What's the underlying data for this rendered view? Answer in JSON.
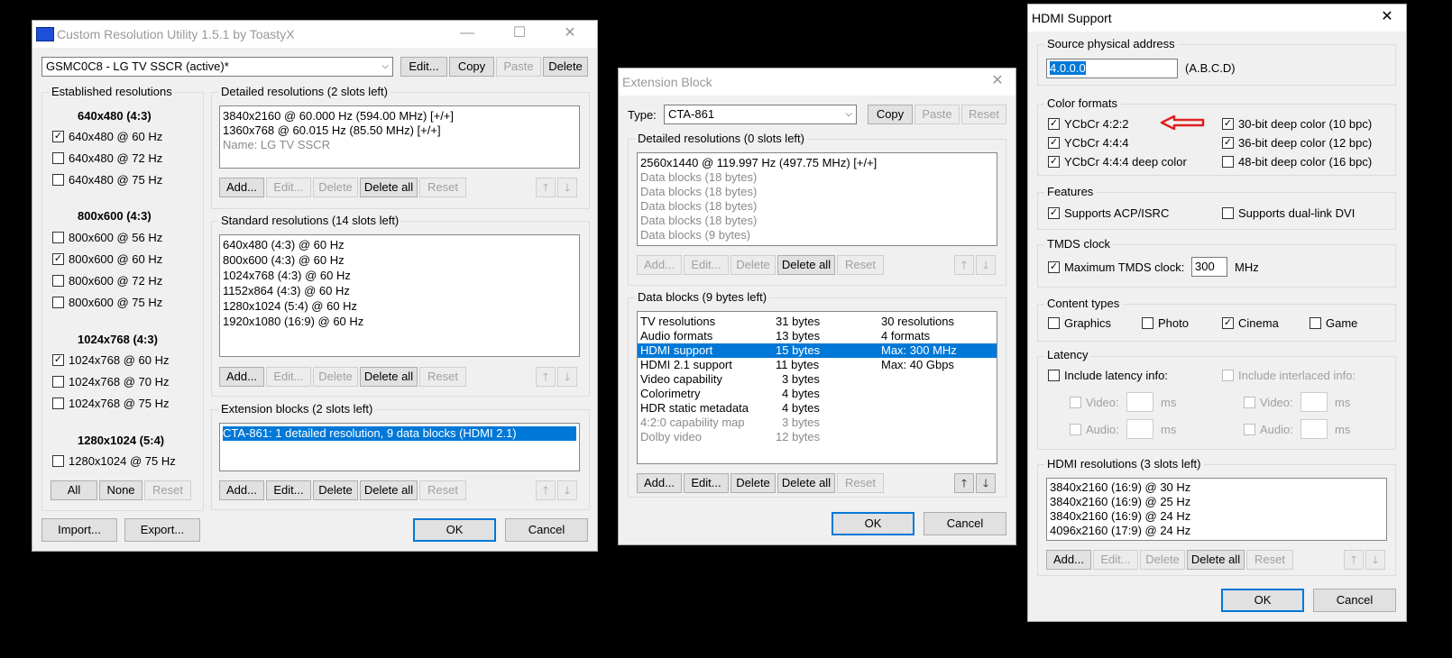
{
  "cru": {
    "title": "Custom Resolution Utility 1.5.1 by ToastyX",
    "monitor": "GSMC0C8 - LG TV SSCR (active)*",
    "top_buttons": [
      "Edit...",
      "Copy",
      "Paste",
      "Delete"
    ],
    "established": {
      "label": "Established resolutions",
      "groups": [
        {
          "header": "640x480 (4:3)",
          "items": [
            {
              "label": "640x480 @ 60 Hz",
              "checked": true
            },
            {
              "label": "640x480 @ 72 Hz",
              "checked": false
            },
            {
              "label": "640x480 @ 75 Hz",
              "checked": false
            }
          ]
        },
        {
          "header": "800x600 (4:3)",
          "items": [
            {
              "label": "800x600 @ 56 Hz",
              "checked": false
            },
            {
              "label": "800x600 @ 60 Hz",
              "checked": true
            },
            {
              "label": "800x600 @ 72 Hz",
              "checked": false
            },
            {
              "label": "800x600 @ 75 Hz",
              "checked": false
            }
          ]
        },
        {
          "header": "1024x768 (4:3)",
          "items": [
            {
              "label": "1024x768 @ 60 Hz",
              "checked": true
            },
            {
              "label": "1024x768 @ 70 Hz",
              "checked": false
            },
            {
              "label": "1024x768 @ 75 Hz",
              "checked": false
            }
          ]
        },
        {
          "header": "1280x1024 (5:4)",
          "items": [
            {
              "label": "1280x1024 @ 75 Hz",
              "checked": false
            }
          ]
        }
      ],
      "buttons": [
        "All",
        "None",
        "Reset"
      ]
    },
    "detailed": {
      "label": "Detailed resolutions (2 slots left)",
      "items": [
        "3840x2160 @ 60.000 Hz (594.00 MHz) [+/+]",
        "1360x768 @ 60.015 Hz (85.50 MHz) [+/+]",
        "Name: LG TV SSCR"
      ]
    },
    "standard": {
      "label": "Standard resolutions (14 slots left)",
      "items": [
        "640x480 (4:3) @ 60 Hz",
        "800x600 (4:3) @ 60 Hz",
        "1024x768 (4:3) @ 60 Hz",
        "1152x864 (4:3) @ 60 Hz",
        "1280x1024 (5:4) @ 60 Hz",
        "1920x1080 (16:9) @ 60 Hz"
      ]
    },
    "extension": {
      "label": "Extension blocks (2 slots left)",
      "items": [
        "CTA-861: 1 detailed resolution, 9 data blocks (HDMI 2.1)"
      ]
    },
    "list_buttons": [
      "Add...",
      "Edit...",
      "Delete",
      "Delete all",
      "Reset"
    ],
    "bottom": {
      "import": "Import...",
      "export": "Export...",
      "ok": "OK",
      "cancel": "Cancel"
    }
  },
  "ext": {
    "title": "Extension Block",
    "type_label": "Type:",
    "type_value": "CTA-861",
    "top_buttons": [
      "Copy",
      "Paste",
      "Reset"
    ],
    "detailed": {
      "label": "Detailed resolutions (0 slots left)",
      "items": [
        "2560x1440 @ 119.997 Hz (497.75 MHz) [+/+]",
        "Data blocks (18 bytes)",
        "Data blocks (18 bytes)",
        "Data blocks (18 bytes)",
        "Data blocks (18 bytes)",
        "Data blocks (9 bytes)"
      ]
    },
    "datablocks": {
      "label": "Data blocks (9 bytes left)",
      "rows": [
        {
          "name": "TV resolutions",
          "size": "31 bytes",
          "info": "30 resolutions"
        },
        {
          "name": "Audio formats",
          "size": "13 bytes",
          "info": "4 formats"
        },
        {
          "name": "HDMI support",
          "size": "15 bytes",
          "info": "Max: 300 MHz"
        },
        {
          "name": "HDMI 2.1 support",
          "size": "11 bytes",
          "info": "Max: 40 Gbps"
        },
        {
          "name": "Video capability",
          "size": "3 bytes",
          "info": ""
        },
        {
          "name": "Colorimetry",
          "size": "4 bytes",
          "info": ""
        },
        {
          "name": "HDR static metadata",
          "size": "4 bytes",
          "info": ""
        },
        {
          "name": "4:2:0 capability map",
          "size": "3 bytes",
          "info": ""
        },
        {
          "name": "Dolby video",
          "size": "12 bytes",
          "info": ""
        }
      ]
    },
    "list_buttons": [
      "Add...",
      "Edit...",
      "Delete",
      "Delete all",
      "Reset"
    ],
    "ok": "OK",
    "cancel": "Cancel"
  },
  "hdmi": {
    "title": "HDMI Support",
    "source": {
      "label": "Source physical address",
      "value": "4.0.0.0",
      "hint": "(A.B.C.D)"
    },
    "color": {
      "label": "Color formats",
      "left": [
        {
          "label": "YCbCr 4:2:2",
          "checked": true
        },
        {
          "label": "YCbCr 4:4:4",
          "checked": true
        },
        {
          "label": "YCbCr 4:4:4 deep color",
          "checked": true
        }
      ],
      "right": [
        {
          "label": "30-bit deep color (10 bpc)",
          "checked": true
        },
        {
          "label": "36-bit deep color (12 bpc)",
          "checked": true
        },
        {
          "label": "48-bit deep color (16 bpc)",
          "checked": false
        }
      ]
    },
    "features": {
      "label": "Features",
      "acp": "Supports ACP/ISRC",
      "dual": "Supports dual-link DVI"
    },
    "tmds": {
      "label": "TMDS clock",
      "check": "Maximum TMDS clock:",
      "value": "300",
      "unit": "MHz"
    },
    "content": {
      "label": "Content types",
      "items": [
        {
          "label": "Graphics",
          "checked": false
        },
        {
          "label": "Photo",
          "checked": false
        },
        {
          "label": "Cinema",
          "checked": true
        },
        {
          "label": "Game",
          "checked": false
        }
      ]
    },
    "latency": {
      "label": "Latency",
      "include": "Include latency info:",
      "interlaced": "Include interlaced info:",
      "video": "Video:",
      "audio": "Audio:",
      "ms": "ms"
    },
    "resolutions": {
      "label": "HDMI resolutions (3 slots left)",
      "items": [
        "3840x2160 (16:9) @ 30 Hz",
        "3840x2160 (16:9) @ 25 Hz",
        "3840x2160 (16:9) @ 24 Hz",
        "4096x2160 (17:9) @ 24 Hz"
      ]
    },
    "list_buttons": [
      "Add...",
      "Edit...",
      "Delete",
      "Delete all",
      "Reset"
    ],
    "ok": "OK",
    "cancel": "Cancel"
  }
}
